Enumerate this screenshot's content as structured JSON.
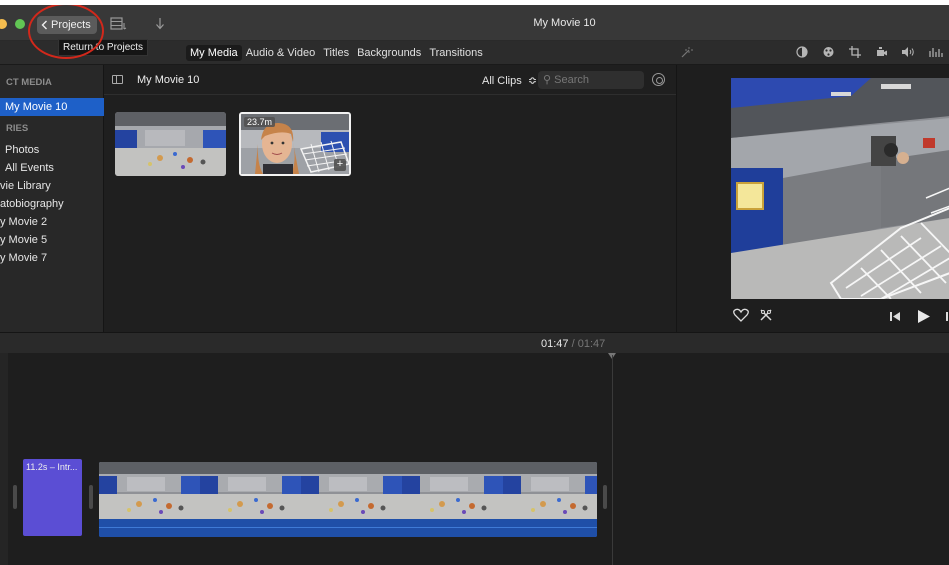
{
  "window": {
    "title": "My Movie 10",
    "back_label": "Projects",
    "tooltip": "Return to Projects"
  },
  "toolbar": {
    "tabs": [
      {
        "label": "My Media",
        "active": true
      },
      {
        "label": "Audio & Video",
        "active": false
      },
      {
        "label": "Titles",
        "active": false
      },
      {
        "label": "Backgrounds",
        "active": false
      },
      {
        "label": "Transitions",
        "active": false
      }
    ],
    "adjust_icons": [
      "color-balance-icon",
      "color-correction-icon",
      "crop-icon",
      "stabilization-icon",
      "volume-icon",
      "equalizer-icon"
    ]
  },
  "sidebar": {
    "project_media_heading": "CT MEDIA",
    "project_item": "My Movie 10",
    "libraries_heading": "RIES",
    "items": [
      "Photos",
      "All Events",
      "vie Library",
      "atobiography",
      "y Movie 2",
      "y Movie 5",
      "y Movie 7"
    ]
  },
  "browser": {
    "title": "My Movie 10",
    "filter": "All Clips",
    "search_placeholder": "Search",
    "clips": [
      {
        "duration": ""
      },
      {
        "duration": "23.7m"
      }
    ]
  },
  "timeline": {
    "current": "01:47",
    "separator": "/",
    "total": "01:47",
    "title_clip": "11.2s – Intr..."
  },
  "colors": {
    "accent": "#1e60c8",
    "title_clip": "#5b4ed4",
    "video_clip": "#2a6ad0",
    "annotation": "#d2281b"
  }
}
